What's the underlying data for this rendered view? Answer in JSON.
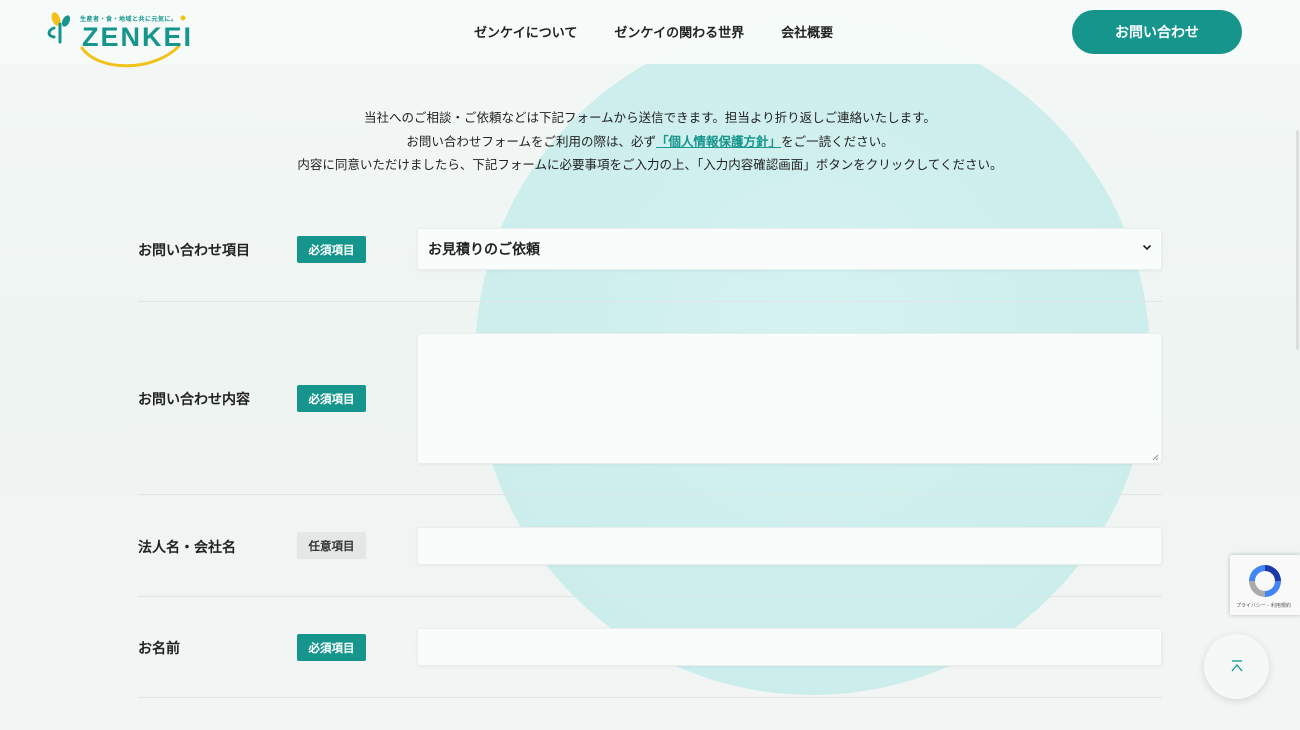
{
  "header": {
    "logo_tagline": "生産者・食・地域と共に元気に。",
    "logo_text": "ZENKEI",
    "nav": [
      "ゼンケイについて",
      "ゼンケイの関わる世界",
      "会社概要"
    ],
    "contact_button": "お問い合わせ"
  },
  "intro": {
    "line1": "当社へのご相談・ご依頼などは下記フォームから送信できます。担当より折り返しご連絡いたします。",
    "line2_before": "お問い合わせフォームをご利用の際は、必ず",
    "line2_link": "「個人情報保護方針」",
    "line2_after": "をご一読ください。",
    "line3": "内容に同意いただけましたら、下記フォームに必要事項をご入力の上、「入力内容確認画面」ボタンをクリックしてください。"
  },
  "form": {
    "inquiry_type": {
      "label": "お問い合わせ項目",
      "badge": "必須項目",
      "selected": "お見積りのご依頼"
    },
    "inquiry_content": {
      "label": "お問い合わせ内容",
      "badge": "必須項目",
      "value": ""
    },
    "company_name": {
      "label": "法人名・会社名",
      "badge": "任意項目",
      "value": ""
    },
    "name": {
      "label": "お名前",
      "badge": "必須項目",
      "value": ""
    }
  },
  "recaptcha": {
    "text": "プライバシー - 利用規約"
  },
  "colors": {
    "accent": "#16958d",
    "logo_yellow": "#f2c21b"
  },
  "icons": [
    "chevron-down-icon",
    "recaptcha-icon",
    "arrow-up-icon"
  ]
}
